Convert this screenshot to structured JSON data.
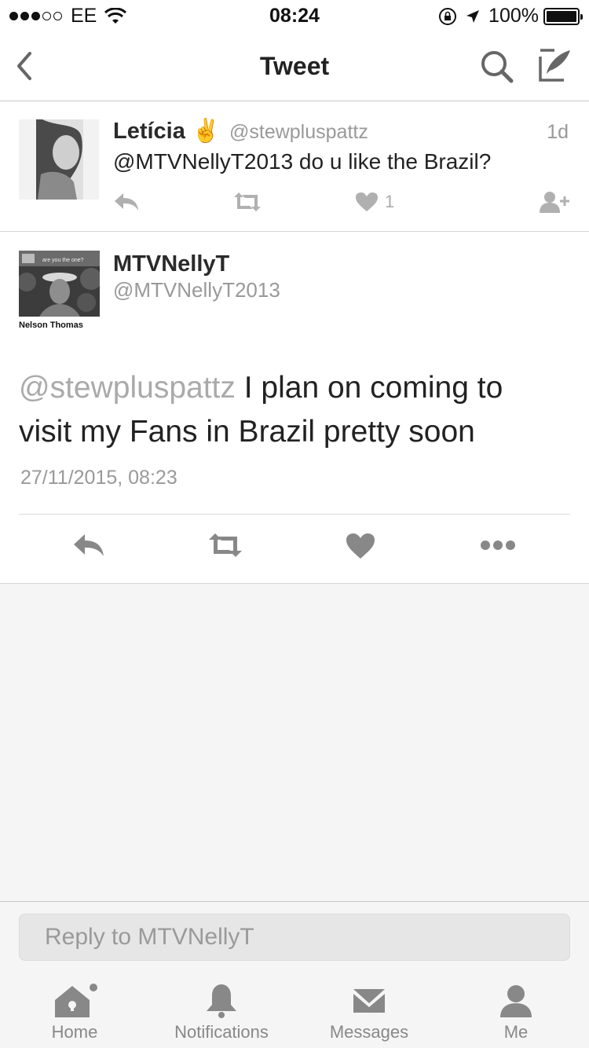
{
  "status_bar": {
    "signal_dots": [
      "filled",
      "filled",
      "filled",
      "empty",
      "empty"
    ],
    "carrier": "EE",
    "time": "08:24",
    "battery": "100%"
  },
  "nav": {
    "title": "Tweet"
  },
  "reply_tweet": {
    "name": "Letícia",
    "emoji": "✌️",
    "handle": "@stewpluspattz",
    "time": "1d",
    "text": "@MTVNellyT2013 do u like the Brazil?",
    "like_count": "1"
  },
  "main_tweet": {
    "name": "MTVNellyT",
    "handle": "@MTVNellyT2013",
    "mention": "@stewpluspattz",
    "text": " I plan on coming to visit my Fans in Brazil pretty soon",
    "date": "27/11/2015, 08:23",
    "avatar_banner": "are you the one?",
    "avatar_caption": "Nelson Thomas"
  },
  "reply_bar": {
    "placeholder": "Reply to MTVNellyT"
  },
  "tabs": [
    {
      "label": "Home",
      "icon": "home-icon"
    },
    {
      "label": "Notifications",
      "icon": "bell-icon"
    },
    {
      "label": "Messages",
      "icon": "envelope-icon"
    },
    {
      "label": "Me",
      "icon": "person-icon"
    }
  ]
}
